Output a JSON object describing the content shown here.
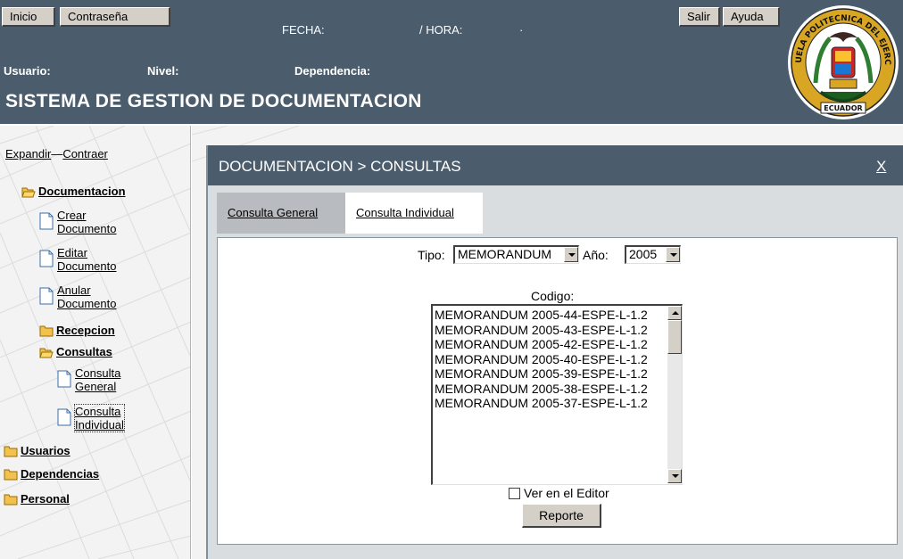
{
  "header": {
    "inicio_label": "Inicio",
    "contrasena_label": "Contraseña",
    "fecha_label": "FECHA:",
    "hora_label": "/ HORA:",
    "hora_value": "·",
    "salir_label": "Salir",
    "ayuda_label": "Ayuda",
    "usuario_label": "Usuario:",
    "nivel_label": "Nivel:",
    "dependencia_label": "Dependencia:",
    "system_title": "SISTEMA DE GESTION DE DOCUMENTACION",
    "logo_text_top": "ESCUELA POLITECNICA DEL EJERCITO",
    "logo_text_bottom": "ECUADOR"
  },
  "sidebar": {
    "expandir": "Expandir",
    "separator": "—",
    "contraer": "Contraer",
    "documentacion": "Documentacion",
    "crear_1": "Crear",
    "crear_2": "Documento",
    "editar_1": "Editar",
    "editar_2": "Documento",
    "anular_1": "Anular",
    "anular_2": "Documento",
    "recepcion": "Recepcion",
    "consultas": "Consultas",
    "consulta_general_1": "Consulta",
    "consulta_general_2": "General",
    "consulta_individual_1": "Consulta",
    "consulta_individual_2": "Individual",
    "usuarios": "Usuarios",
    "dependencias": "Dependencias",
    "personal": "Personal"
  },
  "panel": {
    "title": "DOCUMENTACION > CONSULTAS",
    "close": "X",
    "tab_general": "Consulta General",
    "tab_individual": "Consulta Individual",
    "tipo_label": "Tipo:",
    "tipo_value": "MEMORANDUM",
    "anio_label": "Año:",
    "anio_value": "2005",
    "codigo_label": "Codigo:",
    "codigos": [
      "MEMORANDUM 2005-44-ESPE-L-1.2",
      "MEMORANDUM 2005-43-ESPE-L-1.2",
      "MEMORANDUM 2005-42-ESPE-L-1.2",
      "MEMORANDUM 2005-40-ESPE-L-1.2",
      "MEMORANDUM 2005-39-ESPE-L-1.2",
      "MEMORANDUM 2005-38-ESPE-L-1.2",
      "MEMORANDUM 2005-37-ESPE-L-1.2"
    ],
    "ver_editor": "Ver en el Editor",
    "reporte": "Reporte"
  },
  "colors": {
    "header_bg": "#4b5d6d",
    "panel_bg": "#d9dde0",
    "button_face": "#d4d0c8",
    "folder": "#f2c14e"
  }
}
